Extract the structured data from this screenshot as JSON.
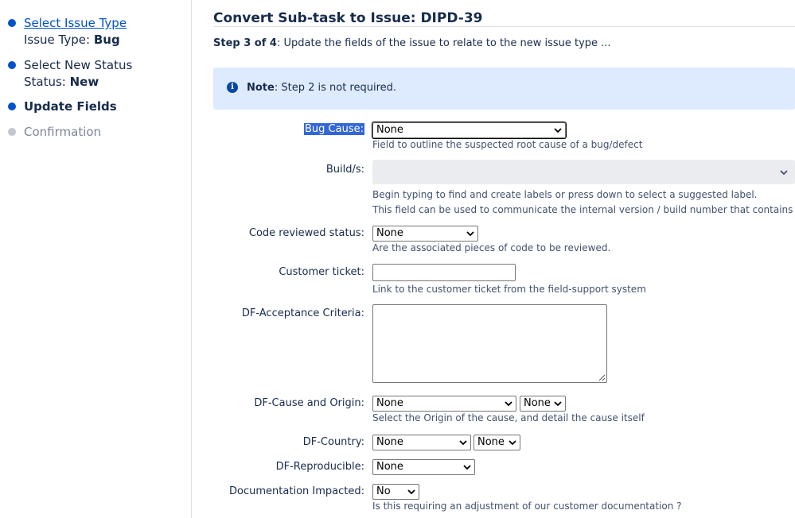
{
  "sidebar": {
    "steps": [
      {
        "label": "Select Issue Type",
        "sub_label": "Issue Type: ",
        "sub_value": "Bug"
      },
      {
        "label": "Select New Status",
        "sub_label": "Status: ",
        "sub_value": "New"
      },
      {
        "label": "Update Fields"
      },
      {
        "label": "Confirmation"
      }
    ]
  },
  "header": {
    "title": "Convert Sub-task to Issue: DIPD-39",
    "step_strong": "Step 3 of 4",
    "step_text": ": Update the fields of the issue to relate to the new issue type ..."
  },
  "note": {
    "icon": "info-icon",
    "strong": "Note",
    "text": ": Step 2 is not required."
  },
  "fields": {
    "bug_cause": {
      "label": "Bug Cause:",
      "value": "None",
      "hint": "Field to outline the suspected root cause of a bug/defect"
    },
    "builds": {
      "label": "Build/s:",
      "hint1": "Begin typing to find and create labels or press down to select a suggested label.",
      "hint2": "This field can be used to communicate the internal version / build number that contains the res"
    },
    "code_reviewed": {
      "label": "Code reviewed status:",
      "value": "None",
      "hint": "Are the associated pieces of code to be reviewed."
    },
    "customer_ticket": {
      "label": "Customer ticket:",
      "value": "",
      "hint": "Link to the customer ticket from the field-support system"
    },
    "acceptance": {
      "label": "DF-Acceptance Criteria:",
      "value": ""
    },
    "cause_origin": {
      "label": "DF-Cause and Origin:",
      "value1": "None",
      "value2": "None",
      "hint": "Select the Origin of the cause, and detail the cause itself"
    },
    "country": {
      "label": "DF-Country:",
      "value1": "None",
      "value2": "None"
    },
    "reproducible": {
      "label": "DF-Reproducible:",
      "value": "None"
    },
    "documentation": {
      "label": "Documentation Impacted:",
      "value": "No",
      "hint": "Is this requiring an adjustment of our customer documentation ?"
    }
  },
  "colors": {
    "accent": "#0052cc",
    "note_bg": "#deebff",
    "highlight": "#3367d6",
    "disabled_bg": "#ebecf0"
  }
}
